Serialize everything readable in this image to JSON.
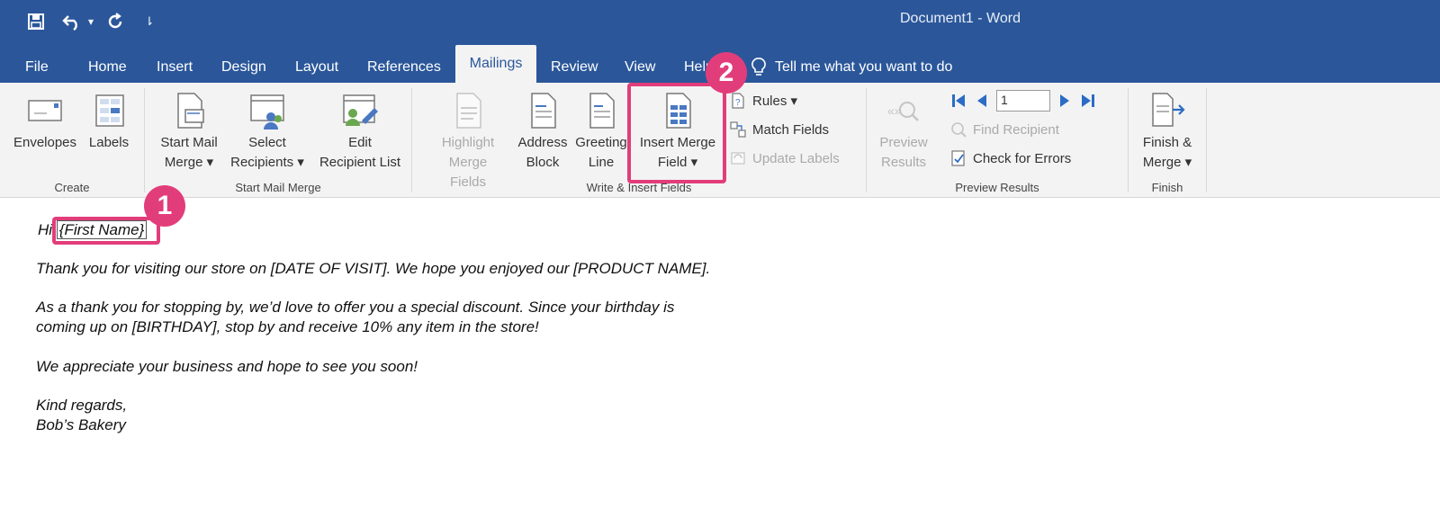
{
  "window": {
    "title": "Document1  -  Word",
    "quick_access": {
      "save_icon": "save-icon",
      "undo_icon": "undo-icon",
      "undo_dropdown": "▾",
      "redo_icon": "repeat-icon",
      "customize_glyph": "⇂"
    }
  },
  "tabs": [
    {
      "label": "File"
    },
    {
      "label": "Home"
    },
    {
      "label": "Insert"
    },
    {
      "label": "Design"
    },
    {
      "label": "Layout"
    },
    {
      "label": "References"
    },
    {
      "label": "Mailings",
      "active": true
    },
    {
      "label": "Review"
    },
    {
      "label": "View"
    },
    {
      "label": "Help"
    }
  ],
  "tell_me": {
    "label": "Tell me what you want to do",
    "icon": "lightbulb-icon"
  },
  "ribbon": {
    "create": {
      "label": "Create",
      "envelopes": "Envelopes",
      "labels": "Labels"
    },
    "start_mail_merge": {
      "label": "Start Mail Merge",
      "start_line1": "Start Mail",
      "start_line2": "Merge ▾",
      "select_line1": "Select",
      "select_line2": "Recipients ▾",
      "edit_line1": "Edit",
      "edit_line2": "Recipient List"
    },
    "write_insert": {
      "label": "Write & Insert Fields",
      "highlight_line1": "Highlight",
      "highlight_line2": "Merge Fields",
      "address_line1": "Address",
      "address_line2": "Block",
      "greeting_line1": "Greeting",
      "greeting_line2": "Line",
      "insert_line1": "Insert Merge",
      "insert_line2": "Field ▾",
      "rules": "Rules ▾",
      "match_fields": "Match Fields",
      "update_labels": "Update Labels"
    },
    "preview": {
      "label": "Preview Results",
      "preview_line1": "Preview",
      "preview_line2": "Results",
      "record_value": "1",
      "find_recipient": "Find Recipient",
      "check_errors": "Check for Errors"
    },
    "finish": {
      "label": "Finish",
      "finish_line1": "Finish &",
      "finish_line2": "Merge ▾"
    }
  },
  "document": {
    "greeting_prefix": "Hi ",
    "merge_field": "{First Name}",
    "para1": "Thank you for visiting our store on [DATE OF VISIT]. We hope you enjoyed our [PRODUCT NAME].",
    "para2_line1": "As a thank you for stopping by, we’d love to offer you a special discount. Since your birthday is",
    "para2_line2": "coming up on [BIRTHDAY], stop by and receive 10% any item in the store!",
    "para3": "We appreciate your business and hope to see you soon!",
    "closing1": "Kind regards,",
    "closing2": "Bob’s Bakery"
  },
  "annotations": {
    "step1": "1",
    "step2": "2",
    "accent": "#e23d7b"
  },
  "colors": {
    "word_blue": "#2b579a",
    "ribbon_bg": "#f3f3f3",
    "accent": "#e23d7b"
  }
}
